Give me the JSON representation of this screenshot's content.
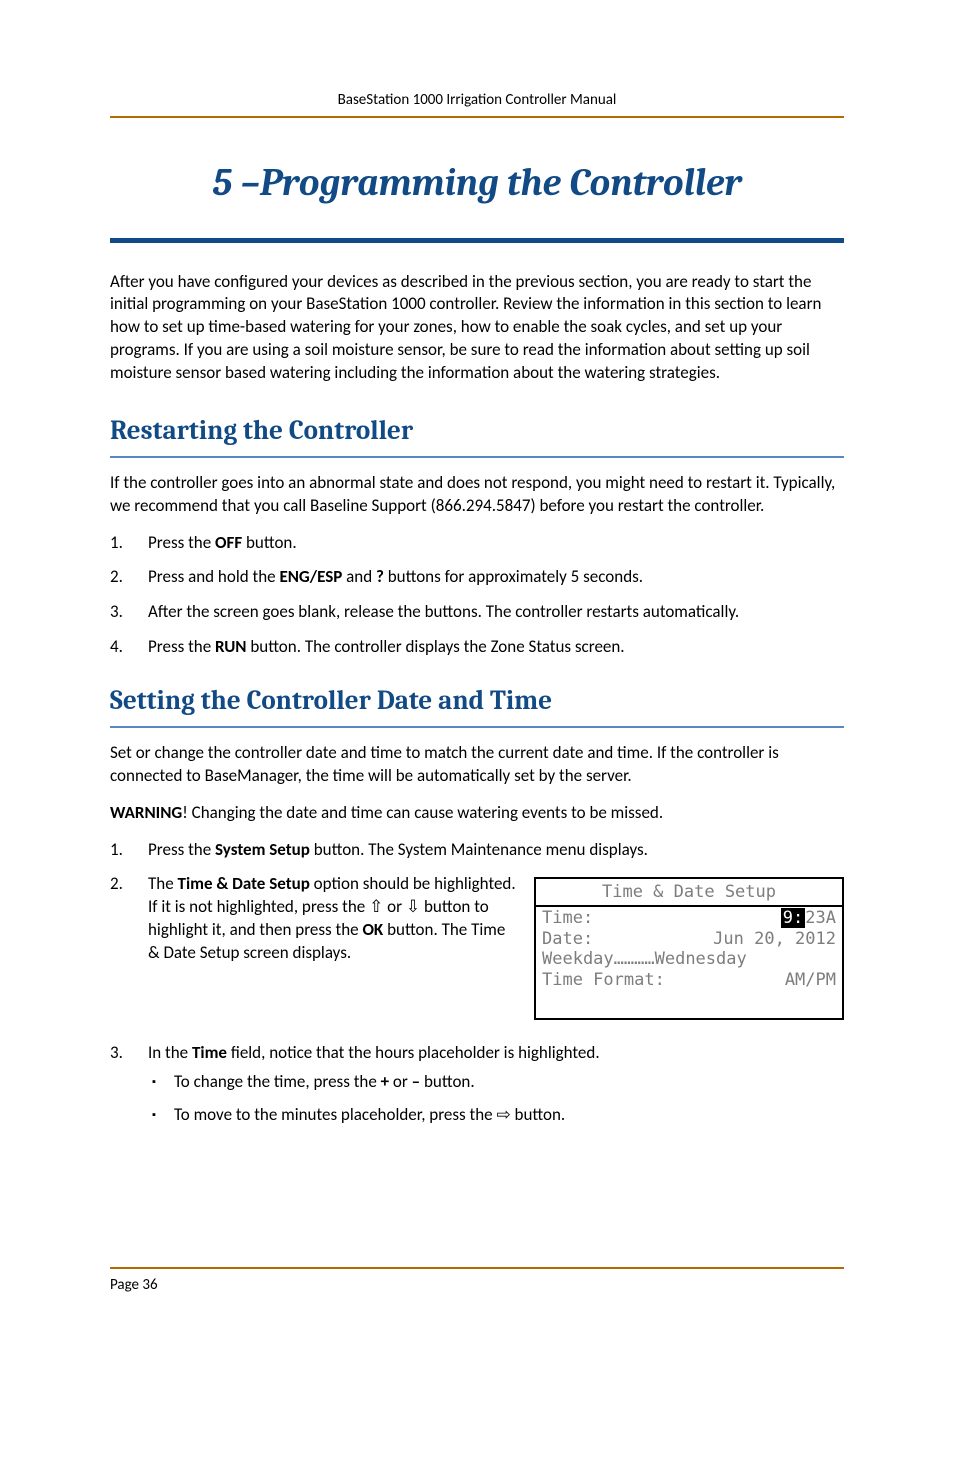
{
  "header": {
    "running": "BaseStation 1000 Irrigation Controller Manual"
  },
  "chapter": {
    "title": "5 –Programming the Controller",
    "intro": "After you have configured your devices as described in the previous section, you are ready to start the initial programming on your BaseStation 1000 controller. Review the information in this section to learn how to set up time-based watering for your zones, how to enable the soak cycles, and set up your programs. If you are using a soil moisture sensor, be sure to read the information about setting up soil moisture sensor based watering including the information about the watering strategies."
  },
  "restart": {
    "title": "Restarting the Controller",
    "lede": "If the controller goes into an abnormal state and does not respond, you might need to restart it. Typically, we recommend that you call Baseline Support (866.294.5847) before you restart the controller.",
    "steps": {
      "s1_a": "Press the ",
      "s1_b": "OFF",
      "s1_c": " button.",
      "s2_a": "Press and hold the ",
      "s2_b": "ENG/ESP",
      "s2_c": " and ",
      "s2_d": "?",
      "s2_e": " buttons for approximately 5 seconds.",
      "s3": "After the screen goes blank, release the buttons. The controller restarts automatically.",
      "s4_a": "Press the ",
      "s4_b": "RUN",
      "s4_c": " button. The controller displays the Zone Status screen."
    }
  },
  "datetime": {
    "title": "Setting the Controller Date and Time",
    "lede": "Set or change the controller date and time to match the current date and time. If the controller is connected to BaseManager, the time will be automatically set by the server.",
    "warn_a": "WARNING",
    "warn_b": "! Changing the date and time can cause watering events to be missed.",
    "steps": {
      "s1_a": "Press the ",
      "s1_b": "System Setup",
      "s1_c": " button. The System Maintenance menu displays.",
      "s2_a": "The ",
      "s2_b": "Time & Date Setup",
      "s2_c": " option should be highlighted. If it is not highlighted, press the ⇧ or ⇩ button to highlight it, and then press the ",
      "s2_d": "OK",
      "s2_e": " button. The Time & Date Setup screen displays.",
      "s3_a": "In the ",
      "s3_b": "Time",
      "s3_c": " field, notice that the hours placeholder is highlighted.",
      "b1_a": "To change the time, press the ",
      "b1_b": "+",
      "b1_c": " or ",
      "b1_d": "–",
      "b1_e": " button.",
      "b2": "To move to the minutes placeholder, press the ⇨ button."
    }
  },
  "lcd": {
    "title": "Time & Date Setup",
    "rows": {
      "time_label": "Time:",
      "time_hours": "9:",
      "time_rest": "23A",
      "date_label": "Date:",
      "date_value": "Jun 20, 2012",
      "weekday_label": "Weekday",
      "weekday_dots": "…………",
      "weekday_value": "Wednesday",
      "fmt_label": "Time Format:",
      "fmt_value": "AM/PM"
    }
  },
  "footer": {
    "page": "Page 36"
  }
}
